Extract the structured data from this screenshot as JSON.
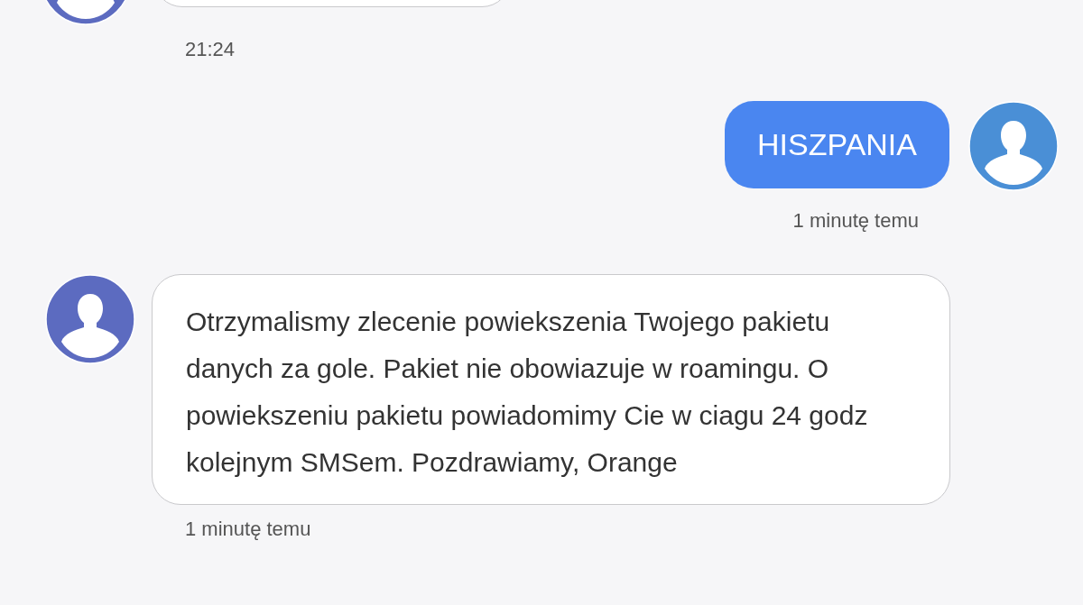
{
  "messages": [
    {
      "kind": "cut",
      "color": "#5c6bc0",
      "time": "21:24"
    },
    {
      "kind": "outgoing",
      "text": "HISZPANIA",
      "color": "#4a8fd6",
      "time": "1 minutę temu"
    },
    {
      "kind": "incoming",
      "text": "Otrzymalismy zlecenie powiekszenia Twojego pakietu danych za gole. Pakiet nie obowiazuje w roamingu. O powiekszeniu pakietu powiadomimy Cie w ciagu 24 godz kolejnym SMSem. Pozdrawiamy, Orange",
      "color": "#5c6bc0",
      "time": "1 minutę temu"
    }
  ]
}
